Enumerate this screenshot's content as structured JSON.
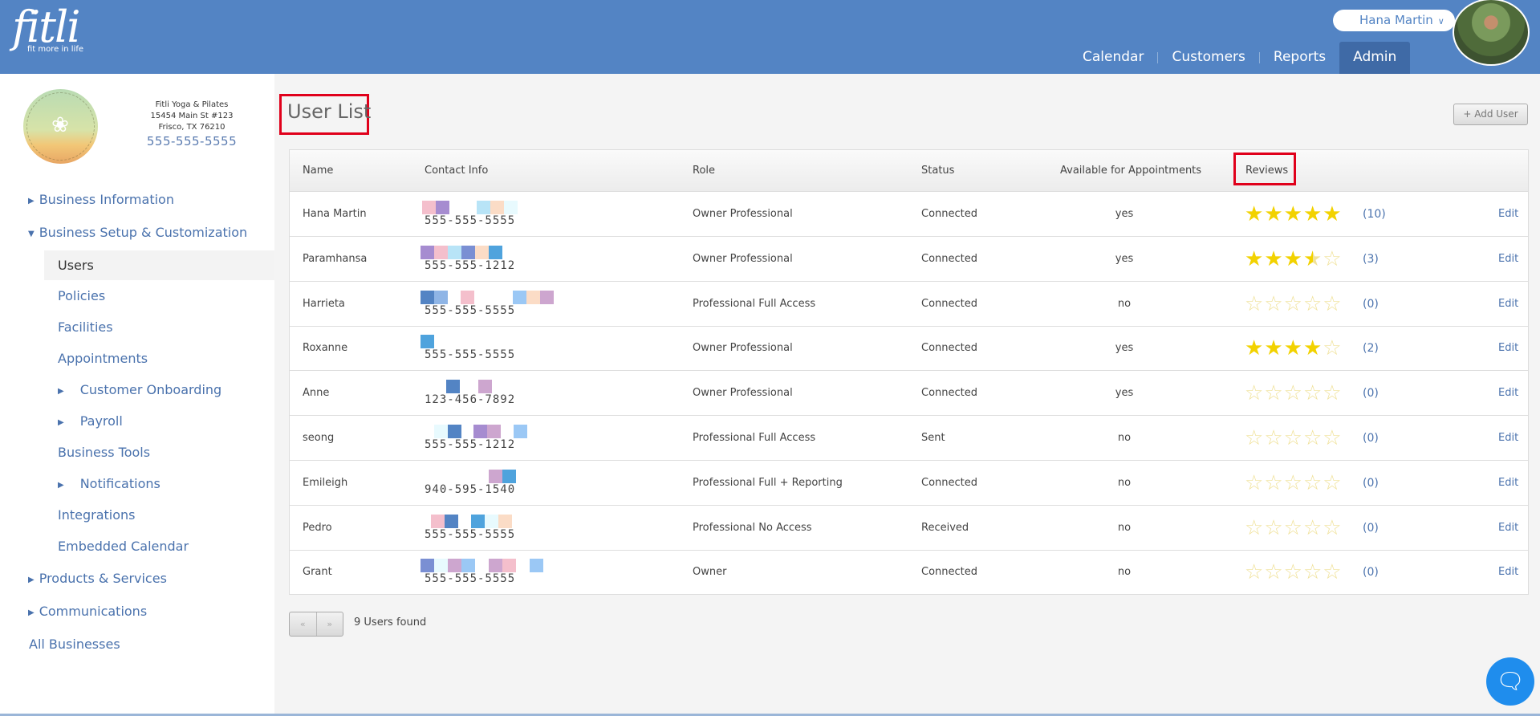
{
  "brand": {
    "name": "fitli",
    "tagline": "fit more in life"
  },
  "user": {
    "name": "Hana Martin",
    "chevron": "chevron-down-icon"
  },
  "nav": {
    "items": [
      "Calendar",
      "Customers",
      "Reports",
      "Admin"
    ],
    "active": "Admin"
  },
  "business": {
    "logo_text": "FITLI YOGA & PILATES",
    "name": "Fitli Yoga & Pilates",
    "address1": "15454 Main St #123",
    "address2": "Frisco, TX 76210",
    "phone": "555-555-5555"
  },
  "sidebar": {
    "items": [
      {
        "label": "Business Information",
        "arrow": "▶"
      },
      {
        "label": "Business Setup & Customization",
        "arrow": "▼"
      },
      {
        "label": "Users"
      },
      {
        "label": "Policies"
      },
      {
        "label": "Facilities"
      },
      {
        "label": "Appointments"
      },
      {
        "label": "Customer Onboarding",
        "arrow": "▶"
      },
      {
        "label": "Payroll",
        "arrow": "▶"
      },
      {
        "label": "Business Tools"
      },
      {
        "label": "Notifications",
        "arrow": "▶"
      },
      {
        "label": "Integrations"
      },
      {
        "label": "Embedded Calendar"
      },
      {
        "label": "Products & Services",
        "arrow": "▶"
      },
      {
        "label": "Communications",
        "arrow": "▶"
      },
      {
        "label": "All Businesses"
      }
    ],
    "selected": "Users"
  },
  "page": {
    "title": "User List",
    "add_button": "+ Add User",
    "found": "9 Users found",
    "pager_prev": "«",
    "pager_next": "»"
  },
  "table": {
    "headers": [
      "Name",
      "Contact Info",
      "Role",
      "Status",
      "Available for Appointments",
      "Reviews"
    ],
    "rows": [
      {
        "name": "Hana Martin",
        "phone": "555-555-5555",
        "role": "Owner Professional",
        "status": "Connected",
        "available": "yes",
        "rating": 5,
        "count": "(10)",
        "edit": "Edit"
      },
      {
        "name": "Paramhansa",
        "phone": "555-555-1212",
        "role": "Owner Professional",
        "status": "Connected",
        "available": "yes",
        "rating": 3.5,
        "count": "(3)",
        "edit": "Edit"
      },
      {
        "name": "Harrieta",
        "phone": "555-555-5555",
        "role": "Professional Full Access",
        "status": "Connected",
        "available": "no",
        "rating": 0,
        "count": "(0)",
        "edit": "Edit"
      },
      {
        "name": "Roxanne",
        "phone": "555-555-5555",
        "role": "Owner Professional",
        "status": "Connected",
        "available": "yes",
        "rating": 4,
        "count": "(2)",
        "edit": "Edit"
      },
      {
        "name": "Anne",
        "phone": "123-456-7892",
        "role": "Owner Professional",
        "status": "Connected",
        "available": "yes",
        "rating": 0,
        "count": "(0)",
        "edit": "Edit"
      },
      {
        "name": "seong",
        "phone": "555-555-1212",
        "role": "Professional Full Access",
        "status": "Sent",
        "available": "no",
        "rating": 0,
        "count": "(0)",
        "edit": "Edit"
      },
      {
        "name": "Emileigh",
        "phone": "940-595-1540",
        "role": "Professional Full + Reporting",
        "status": "Connected",
        "available": "no",
        "rating": 0,
        "count": "(0)",
        "edit": "Edit"
      },
      {
        "name": "Pedro",
        "phone": "555-555-5555",
        "role": "Professional No Access",
        "status": "Received",
        "available": "no",
        "rating": 0,
        "count": "(0)",
        "edit": "Edit"
      },
      {
        "name": "Grant",
        "phone": "555-555-5555",
        "role": "Owner",
        "status": "Connected",
        "available": "no",
        "rating": 0,
        "count": "(0)",
        "edit": "Edit"
      }
    ]
  },
  "colors": {
    "header_bg": "#5384c4",
    "link": "#4a72ad",
    "star_on": "#f2d200",
    "star_off": "#f0e29a",
    "highlight": "#e0001b",
    "chat": "#1f8ded"
  },
  "chat": {
    "icon": "chat-bubble-icon"
  }
}
